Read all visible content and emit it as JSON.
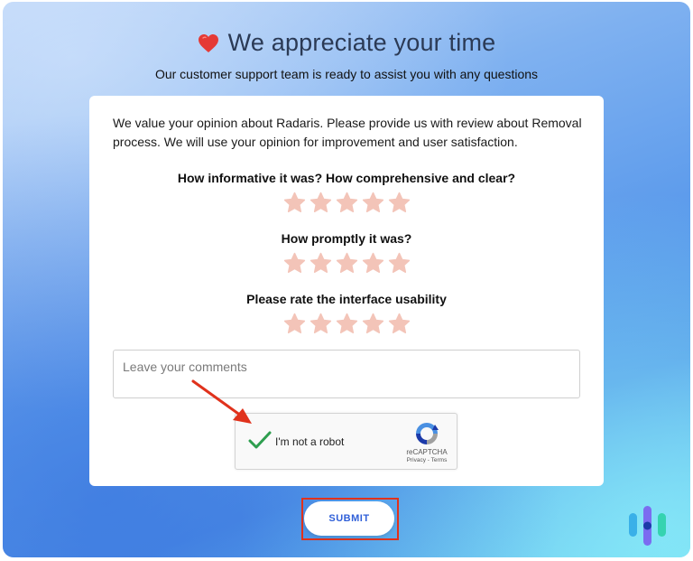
{
  "header": {
    "title": "We appreciate your time",
    "subtitle": "Our customer support team is ready to assist you with any questions"
  },
  "form": {
    "intro": "We value your opinion about Radaris. Please provide us with review about Removal process. We will use your opinion for improvement and user satisfaction.",
    "questions": [
      {
        "label": "How informative it was? How comprehensive and clear?",
        "rating": 0,
        "max": 5
      },
      {
        "label": "How promptly it was?",
        "rating": 0,
        "max": 5
      },
      {
        "label": "Please rate the interface usability",
        "rating": 0,
        "max": 5
      }
    ],
    "comments_placeholder": "Leave your comments",
    "comments_value": ""
  },
  "captcha": {
    "label": "I'm not a robot",
    "checked": true,
    "brand": "reCAPTCHA",
    "links": "Privacy - Terms"
  },
  "submit_label": "SUBMIT",
  "colors": {
    "star": "#f3c4b8",
    "heart": "#e53935",
    "annotation": "#e0321c",
    "submit_text": "#2f5fd8",
    "check": "#2e9e4f"
  }
}
